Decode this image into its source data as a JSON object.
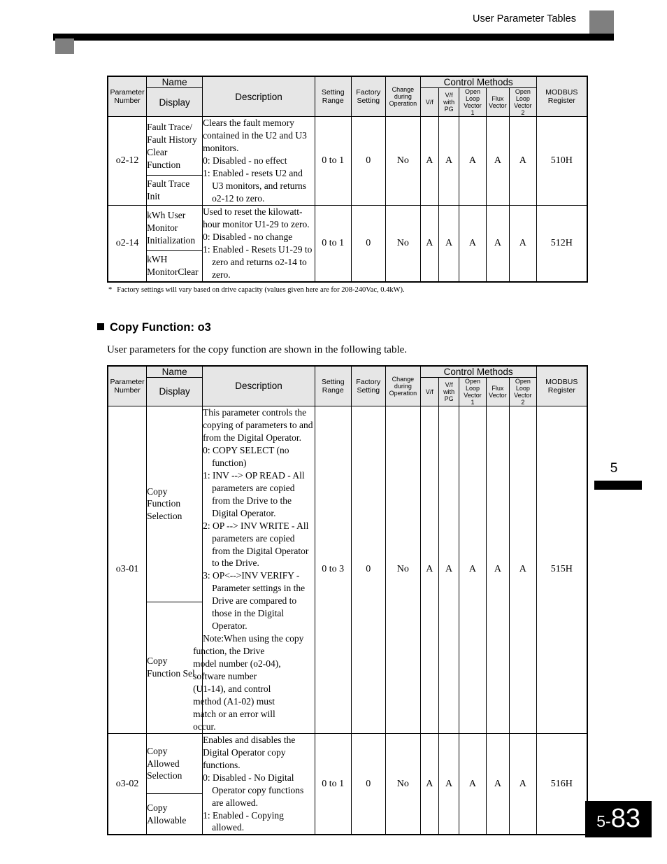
{
  "header": {
    "title": "User Parameter Tables"
  },
  "chapter_tab": {
    "number": "5"
  },
  "footer": {
    "chapter": "5-",
    "page": "83"
  },
  "table_header": {
    "parameter_number": "Parameter\nNumber",
    "name": "Name",
    "display": "Display",
    "description": "Description",
    "setting_range": "Setting\nRange",
    "factory_setting": "Factory\nSetting",
    "change_during_operation": "Change\nduring\nOperation",
    "control_methods": "Control Methods",
    "vf": "V/f",
    "vf_with_pg": "V/f\nwith\nPG",
    "open_loop_vector_1": "Open\nLoop\nVector\n1",
    "flux_vector": "Flux\nVector",
    "open_loop_vector_2": "Open\nLoop\nVector\n2",
    "modbus_register": "MODBUS\nRegister"
  },
  "table_o2": {
    "rows": [
      {
        "parameter_number": "o2-12",
        "name": "Fault Trace/\nFault History\nClear\nFunction",
        "display": "Fault Trace\nInit",
        "description_lines": [
          {
            "text": "Clears the fault memory",
            "style": "plain"
          },
          {
            "text": "contained in the U2 and U3",
            "style": "plain"
          },
          {
            "text": "monitors.",
            "style": "plain"
          },
          {
            "text": "0: Disabled - no effect",
            "style": "hang"
          },
          {
            "text": "1: Enabled - resets U2 and",
            "style": "hang"
          },
          {
            "text": "U3 monitors, and returns",
            "style": "cont"
          },
          {
            "text": "o2-12 to zero.",
            "style": "cont"
          }
        ],
        "setting_range": "0 to 1",
        "factory_setting": "0",
        "change_during_operation": "No",
        "vf": "A",
        "vf_with_pg": "A",
        "open_loop_vector_1": "A",
        "flux_vector": "A",
        "open_loop_vector_2": "A",
        "modbus_register": "510H"
      },
      {
        "parameter_number": "o2-14",
        "name": "kWh User\nMonitor\nInitialization",
        "display": "kWH\nMonitorClear",
        "description_lines": [
          {
            "text": "Used to reset the kilowatt-",
            "style": "plain"
          },
          {
            "text": "hour monitor U1-29 to zero.",
            "style": "plain"
          },
          {
            "text": "0: Disabled - no change",
            "style": "hang"
          },
          {
            "text": "1: Enabled - Resets U1-29 to",
            "style": "hang"
          },
          {
            "text": "zero and returns o2-14 to",
            "style": "cont"
          },
          {
            "text": "zero.",
            "style": "cont"
          }
        ],
        "setting_range": "0 to 1",
        "factory_setting": "0",
        "change_during_operation": "No",
        "vf": "A",
        "vf_with_pg": "A",
        "open_loop_vector_1": "A",
        "flux_vector": "A",
        "open_loop_vector_2": "A",
        "modbus_register": "512H"
      }
    ]
  },
  "footnote": {
    "mark": "*",
    "text": "Factory settings will vary based on drive capacity (values given here are for 208-240Vac, 0.4kW)."
  },
  "section": {
    "heading": "Copy Function: o3",
    "intro": "User parameters for the copy function are shown in the following table."
  },
  "table_o3": {
    "rows": [
      {
        "parameter_number": "o3-01",
        "name": "Copy\nFunction\nSelection",
        "display": "Copy\nFunction Sel",
        "description_lines": [
          {
            "text": "This parameter controls the",
            "style": "plain"
          },
          {
            "text": "copying of parameters to and",
            "style": "plain"
          },
          {
            "text": "from the Digital Operator.",
            "style": "plain"
          },
          {
            "text": "0: COPY SELECT (no",
            "style": "hang"
          },
          {
            "text": "function)",
            "style": "cont"
          },
          {
            "text": "1: INV --> OP READ - All",
            "style": "hang"
          },
          {
            "text": "parameters are copied",
            "style": "cont"
          },
          {
            "text": "from the Drive to the",
            "style": "cont"
          },
          {
            "text": "Digital Operator.",
            "style": "cont"
          },
          {
            "text": "2: OP --> INV WRITE - All",
            "style": "hang"
          },
          {
            "text": "parameters are copied",
            "style": "cont"
          },
          {
            "text": "from the Digital Operator",
            "style": "cont"
          },
          {
            "text": "to the Drive.",
            "style": "cont"
          },
          {
            "text": "3: OP<-->INV VERIFY -",
            "style": "hang"
          },
          {
            "text": "Parameter settings in the",
            "style": "cont"
          },
          {
            "text": "Drive are compared to",
            "style": "cont"
          },
          {
            "text": "those in the Digital",
            "style": "cont"
          },
          {
            "text": "Operator.",
            "style": "cont"
          },
          {
            "text": "Note:When using the copy",
            "style": "hang2"
          },
          {
            "text": "function, the Drive",
            "style": "cont2"
          },
          {
            "text": "model number (o2-04),",
            "style": "cont2"
          },
          {
            "text": "software number",
            "style": "cont2"
          },
          {
            "text": "(U1-14), and control",
            "style": "cont2"
          },
          {
            "text": "method (A1-02) must",
            "style": "cont2"
          },
          {
            "text": "match or an error will",
            "style": "cont2"
          },
          {
            "text": "occur.",
            "style": "cont2"
          }
        ],
        "setting_range": "0 to 3",
        "factory_setting": "0",
        "change_during_operation": "No",
        "vf": "A",
        "vf_with_pg": "A",
        "open_loop_vector_1": "A",
        "flux_vector": "A",
        "open_loop_vector_2": "A",
        "modbus_register": "515H"
      },
      {
        "parameter_number": "o3-02",
        "name": "Copy\nAllowed\nSelection",
        "display": "Copy\nAllowable",
        "description_lines": [
          {
            "text": "Enables and disables the",
            "style": "plain"
          },
          {
            "text": "Digital Operator copy",
            "style": "plain"
          },
          {
            "text": "functions.",
            "style": "plain"
          },
          {
            "text": "0: Disabled - No Digital",
            "style": "hang"
          },
          {
            "text": "Operator copy functions",
            "style": "cont"
          },
          {
            "text": "are allowed.",
            "style": "cont"
          },
          {
            "text": "1: Enabled - Copying",
            "style": "hang"
          },
          {
            "text": "allowed.",
            "style": "cont"
          }
        ],
        "setting_range": "0 to 1",
        "factory_setting": "0",
        "change_during_operation": "No",
        "vf": "A",
        "vf_with_pg": "A",
        "open_loop_vector_1": "A",
        "flux_vector": "A",
        "open_loop_vector_2": "A",
        "modbus_register": "516H"
      }
    ]
  }
}
